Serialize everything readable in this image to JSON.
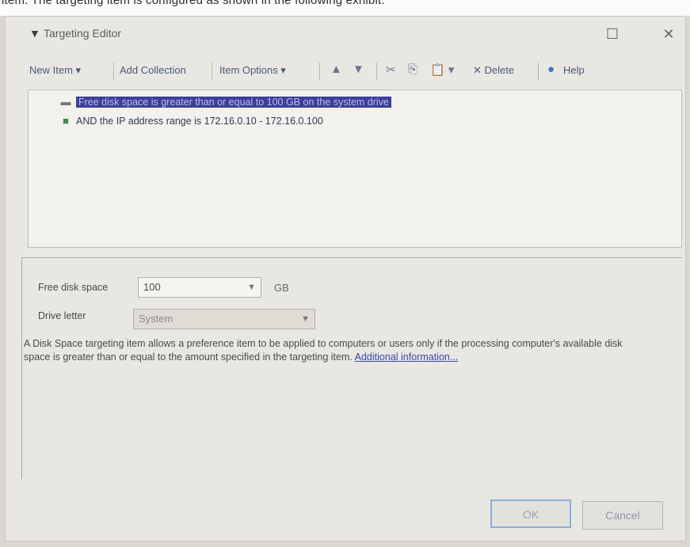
{
  "top_text": "item. The targeting item is configured as shown in the following exhibit.",
  "window": {
    "title": "Targeting Editor",
    "maximize": "☐",
    "close": "✕"
  },
  "toolbar": {
    "new_item": "New Item ▾",
    "add_collection": "Add Collection",
    "item_options": "Item Options ▾",
    "move_up": "▲",
    "move_down": "▼",
    "cut": "✂",
    "copy": "⎘",
    "paste": "📋 ▾",
    "delete": "✕ Delete",
    "help": "Help"
  },
  "tree": {
    "items": [
      {
        "label": "Free disk space is greater than or equal to 100 GB on the system drive",
        "icon": "disk-icon",
        "selected": true
      },
      {
        "label": "AND the IP address range is 172.16.0.10 - 172.16.0.100",
        "icon": "network-icon",
        "selected": false
      }
    ]
  },
  "properties": {
    "free_disk_label": "Free disk space",
    "free_disk_value": "100",
    "unit": "GB",
    "drive_letter_label": "Drive letter",
    "drive_letter_value": "System",
    "description": "A Disk Space targeting item allows a preference item to be applied to computers or users only if the processing computer's available disk space is greater than or equal to the amount specified in the targeting item.",
    "link": "Additional information..."
  },
  "buttons": {
    "ok": "OK",
    "cancel": "Cancel"
  },
  "colors": {
    "selection": "#3b3f9a",
    "link": "#3b4aa8"
  }
}
